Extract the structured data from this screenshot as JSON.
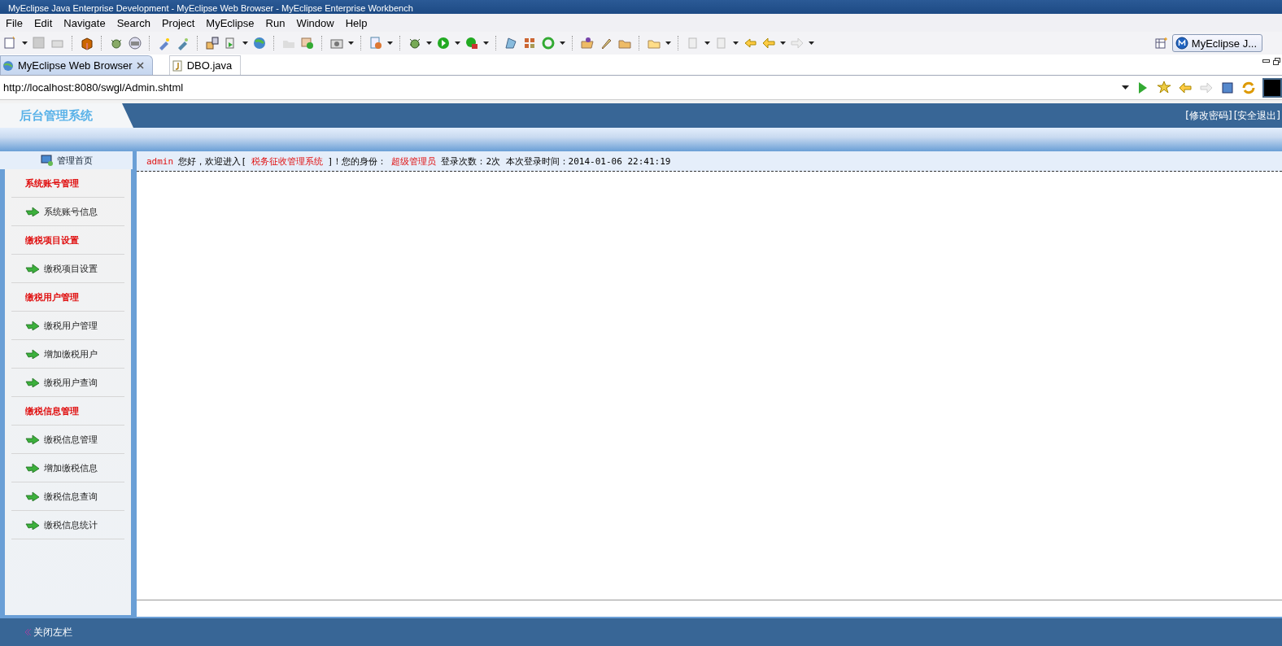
{
  "window": {
    "title": "MyEclipse Java Enterprise Development - MyEclipse Web Browser - MyEclipse Enterprise Workbench"
  },
  "menu": [
    "File",
    "Edit",
    "Navigate",
    "Search",
    "Project",
    "MyEclipse",
    "Run",
    "Window",
    "Help"
  ],
  "perspective": {
    "label": "MyEclipse J..."
  },
  "editor_tabs": [
    {
      "label": "MyEclipse Web Browser",
      "selected": true,
      "closable": true,
      "kind": "browser"
    },
    {
      "label": "DBO.java",
      "selected": false,
      "closable": false,
      "kind": "java"
    }
  ],
  "address_bar": {
    "url": "http://localhost:8080/swgl/Admin.shtml"
  },
  "page": {
    "logo": "后台管理系统",
    "header_links": [
      "[修改密码]",
      "[安全退出]"
    ],
    "sidebar": {
      "home": "管理首页",
      "groups": [
        {
          "title": "系统账号管理",
          "items": [
            "系统账号信息"
          ]
        },
        {
          "title": "缴税项目设置",
          "items": [
            "缴税项目设置"
          ]
        },
        {
          "title": "缴税用户管理",
          "items": [
            "缴税用户管理",
            "增加缴税用户",
            "缴税用户查询"
          ]
        },
        {
          "title": "缴税信息管理",
          "items": [
            "缴税信息管理",
            "增加缴税信息",
            "缴税信息查询",
            "缴税信息统计"
          ]
        }
      ]
    },
    "welcome": [
      {
        "text": "admin",
        "emphasis": true
      },
      {
        "text": "您好，欢迎进入[",
        "emphasis": false
      },
      {
        "text": "税务征收管理系统",
        "emphasis": true
      },
      {
        "text": "]！您的身份：",
        "emphasis": false
      },
      {
        "text": "超级管理员",
        "emphasis": true
      },
      {
        "text": "登录次数：2次 本次登录时间：2014-01-06 22:41:19",
        "emphasis": false
      }
    ],
    "footer": {
      "toggle": "关闭左栏"
    }
  }
}
